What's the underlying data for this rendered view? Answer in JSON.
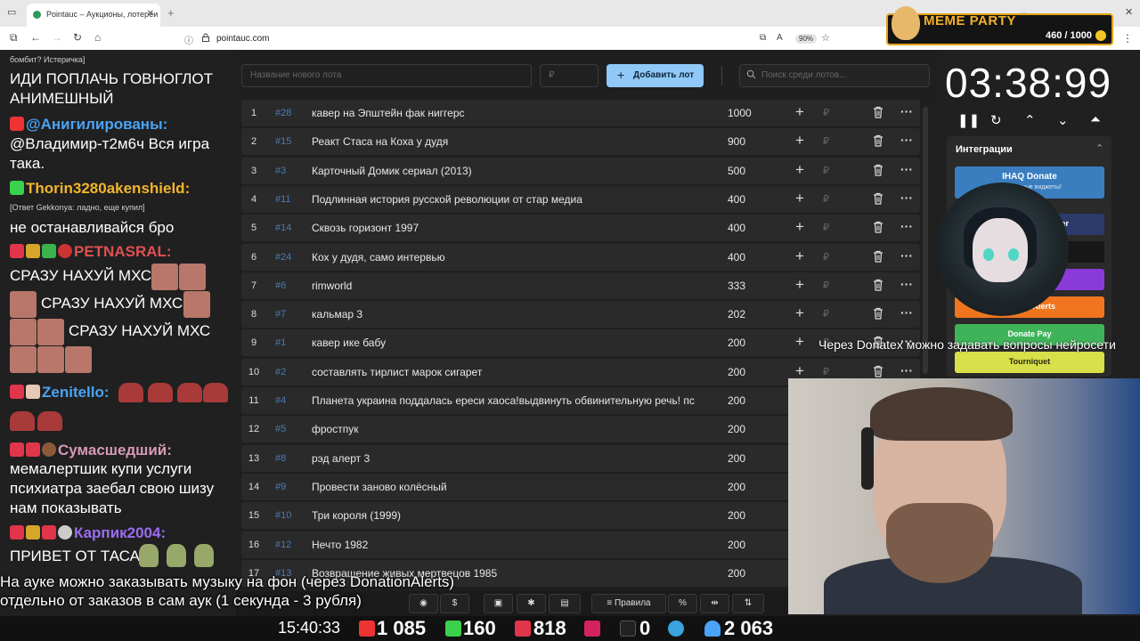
{
  "browser": {
    "tab_title": "Pointauc – Аукционы, лотереи",
    "url": "pointauc.com",
    "zoom": "90%"
  },
  "overlay": {
    "meme_title": "MEME PARTY",
    "meme_count": "460 / 1000"
  },
  "chat": {
    "reply_small_1": "бомбит? Истеричка]",
    "line_1": "ИДИ ПОПЛАЧЬ ГОВНОГЛОТ",
    "line_2": "АНИМЕШНЫЙ",
    "user_1": "@Анигилированы:",
    "msg_1a": "@Владимир-т2м6ч Вся игра",
    "msg_1b": "така.",
    "user_2": "Thorin3280akenshield:",
    "reply_small_2": "[Ответ Gekkonya: ладно, еще купил]",
    "msg_2": "не останавливайся бро",
    "user_3": "РЕТNASRAL:",
    "msg_3a": "СРАЗУ НАХУЙ МХС",
    "msg_3b": "СРАЗУ НАХУЙ МХС",
    "msg_3c": "СРАЗУ НАХУЙ МХС",
    "user_4": "Zenitello:",
    "user_5": "Сумасшедший:",
    "msg_5a": "мемалертшик купи услуги",
    "msg_5b": "психиатра заебал свою шизу",
    "msg_5c": "нам показывать",
    "user_6": "Карпик2004:",
    "msg_6": "ПРИВЕТ ОТ ТАСА"
  },
  "controls": {
    "lot_placeholder": "Название нового лота",
    "price_placeholder": "₽",
    "add_label": "Добавить лот",
    "search_placeholder": "Поиск среди лотов..."
  },
  "lots": [
    {
      "num": "1",
      "id": "#28",
      "title": "кавер на Эпштейн фак ниггерс",
      "amount": "1000"
    },
    {
      "num": "2",
      "id": "#15",
      "title": "Реакт Стаса на Коха у дудя",
      "amount": "900"
    },
    {
      "num": "3",
      "id": "#3",
      "title": "Карточный Домик сериал (2013)",
      "amount": "500"
    },
    {
      "num": "4",
      "id": "#11",
      "title": "Подлинная история русской революции от стар медиа",
      "amount": "400"
    },
    {
      "num": "5",
      "id": "#14",
      "title": "Сквозь горизонт 1997",
      "amount": "400"
    },
    {
      "num": "6",
      "id": "#24",
      "title": "Кох у дудя, само интервью",
      "amount": "400"
    },
    {
      "num": "7",
      "id": "#6",
      "title": "rimworld",
      "amount": "333"
    },
    {
      "num": "8",
      "id": "#7",
      "title": "кальмар 3",
      "amount": "202"
    },
    {
      "num": "9",
      "id": "#1",
      "title": "кавер ике бабу",
      "amount": "200"
    },
    {
      "num": "10",
      "id": "#2",
      "title": "составлять тирлист марок сигарет",
      "amount": "200"
    },
    {
      "num": "11",
      "id": "#4",
      "title": "Планета украина поддалась ереси хаоса!выдвинуть обвинительную речь! пс",
      "amount": "200"
    },
    {
      "num": "12",
      "id": "#5",
      "title": "фростпук",
      "amount": "200"
    },
    {
      "num": "13",
      "id": "#8",
      "title": "рэд алерт 3",
      "amount": "200"
    },
    {
      "num": "14",
      "id": "#9",
      "title": "Провести заново колёсный",
      "amount": "200"
    },
    {
      "num": "15",
      "id": "#10",
      "title": "Три короля (1999)",
      "amount": "200"
    },
    {
      "num": "16",
      "id": "#12",
      "title": "Нечто 1982",
      "amount": "200"
    },
    {
      "num": "17",
      "id": "#13",
      "title": "Возвращение живых мертвецов 1985",
      "amount": "200"
    }
  ],
  "currency_symbol": "₽",
  "timer": {
    "value": "03:38:99"
  },
  "integrations": {
    "title": "Интеграции",
    "ihaq": "IHAQ Donate",
    "ihaq_sub": "Уникальные виджеты!",
    "partial_1": "er",
    "alerts": "Alerts",
    "donatepay": "Donate Pay",
    "tourniquet": "Tourniquet"
  },
  "donatex_note": "Через Donatex можно задавать вопросы нейросети",
  "toolbar": {
    "rules": "Правила"
  },
  "auk_note_1": "На ауке можно заказывать музыку на фон (через DonationAlerts)",
  "auk_note_2": "отдельно от заказов в сам аук (1 секунда - 3 рубля)",
  "stats": {
    "clock": "15:40:33",
    "youtube": "1 085",
    "kick": "160",
    "vklive": "818",
    "rutube": "0",
    "viewers": "2 063"
  },
  "colors": {
    "accent_button": "#90c8f8",
    "lot_id": "#4c7bb0",
    "meme_gold": "#f3b02a"
  }
}
